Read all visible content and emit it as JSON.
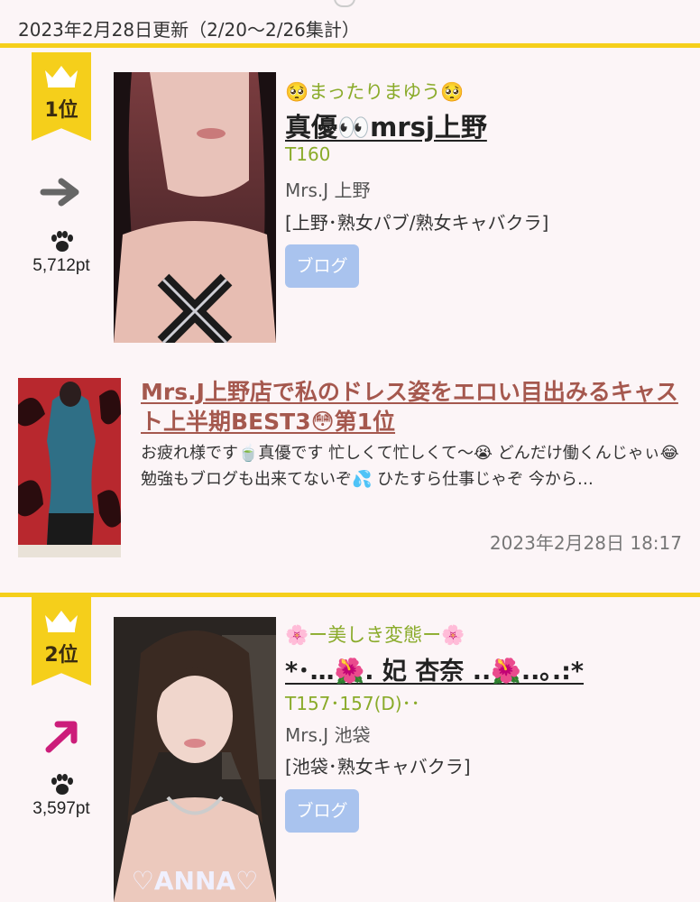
{
  "header": {
    "updated_text": "2023年2月28日更新（2/20〜2/26集計）"
  },
  "ranking": [
    {
      "rank_label": "1位",
      "trend": "flat",
      "trend_icon": "arrow-right-icon",
      "points": "5,712pt",
      "catchphrase": "🥺まったりまゆう🥺",
      "cast_name": "真優👀mrsj上野",
      "height": "T160",
      "shop": "Mrs.J 上野",
      "category": "[上野･熟女パブ/熟女キャバクラ]",
      "blog_button": "ブログ"
    },
    {
      "rank_label": "2位",
      "trend": "up",
      "trend_icon": "arrow-up-right-icon",
      "points": "3,597pt",
      "catchphrase": "🌸ー美しき変態ー🌸",
      "cast_name": "*･…🌺. 妃 杏奈 ..🌺..｡.:*",
      "height": "T157･157(D)･･",
      "shop": "Mrs.J 池袋",
      "category": "[池袋･熟女キャバクラ]",
      "blog_button": "ブログ",
      "photo_overlay": "♡ANNA♡"
    }
  ],
  "blog_post": {
    "title": "Mrs.J上野店で私のドレス姿をエロい目出みるキャスト上半期BEST3😳第1位",
    "excerpt": "お疲れ様です🍵真優です 忙しくて忙しくて〜😭 どんだけ働くんじゃぃ😂 勉強もブログも出来てないぞ💦 ひたすら仕事じゃぞ 今から…",
    "date": "2023年2月28日 18:17"
  },
  "colors": {
    "accent_yellow": "#f5cf1b",
    "catchphrase_green": "#8aab2a",
    "blog_button_blue": "#a9c3ee",
    "blog_title_brown": "#a5584e",
    "background": "#fcf5f7"
  }
}
